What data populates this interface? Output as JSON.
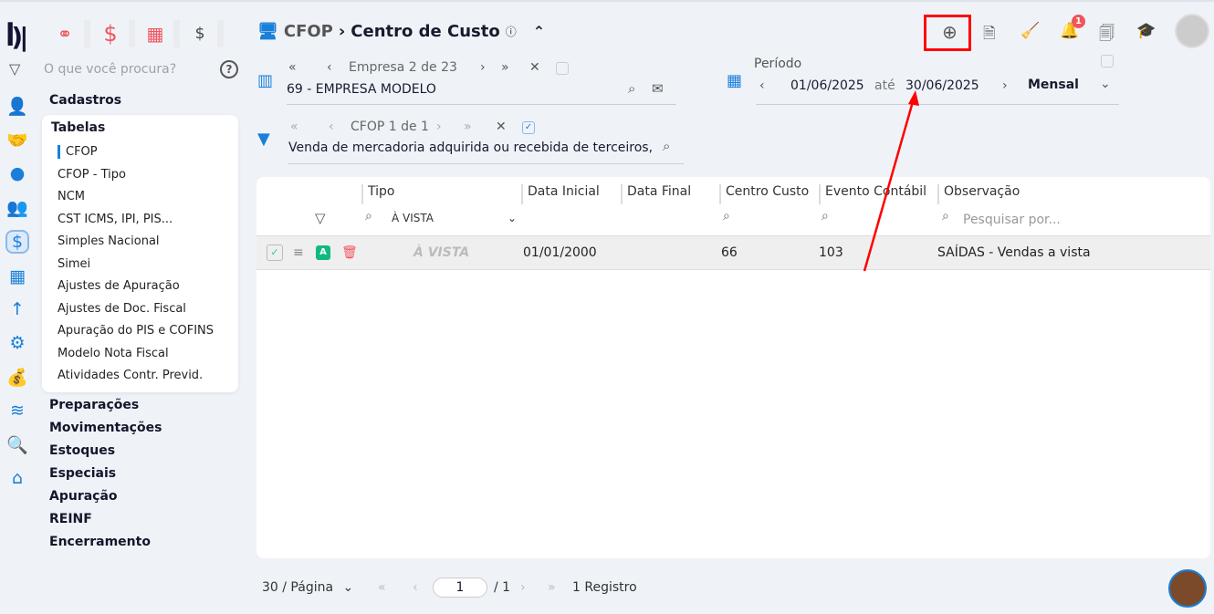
{
  "search": {
    "placeholder": "O que você procura?",
    "help": "?"
  },
  "logo": "PI",
  "modules": [
    {
      "icon": "people-icon",
      "glyph": "👥"
    },
    {
      "icon": "dollar-icon",
      "glyph": "$"
    },
    {
      "icon": "calculator-icon",
      "glyph": "▦"
    },
    {
      "icon": "money-bag-icon",
      "glyph": "💰"
    }
  ],
  "menu": {
    "cadastros": "Cadastros",
    "tabelas": "Tabelas",
    "tabelas_items": [
      "CFOP",
      "CFOP - Tipo",
      "NCM",
      "CST ICMS, IPI, PIS...",
      "Simples Nacional",
      "Simei",
      "Ajustes de Apuração",
      "Ajustes de Doc. Fiscal",
      "Apuração do PIS e COFINS",
      "Modelo Nota Fiscal",
      "Atividades Contr. Previd."
    ],
    "sections": [
      "Preparações",
      "Movimentações",
      "Estoques",
      "Especiais",
      "Apuração",
      "REINF",
      "Encerramento"
    ]
  },
  "breadcrumb": {
    "parent": "CFOP",
    "current": "Centro de Custo"
  },
  "empresa": {
    "nav": "Empresa",
    "pos": "2",
    "of": "de 23",
    "value": "69 - EMPRESA MODELO"
  },
  "periodo": {
    "label": "Período",
    "start": "01/06/2025",
    "sep": "até",
    "end": "30/06/2025",
    "mode": "Mensal"
  },
  "cfop": {
    "nav": "CFOP 1 de 1",
    "value": "Venda de mercadoria adquirida ou recebida de terceiros,"
  },
  "notifications": {
    "count": "1"
  },
  "table": {
    "headers": [
      "Tipo",
      "Data Inicial",
      "Data Final",
      "Centro Custo",
      "Evento Contábil",
      "Observação"
    ],
    "tipo_filter": "À VISTA",
    "obs_placeholder": "Pesquisar por...",
    "rows": [
      {
        "badge": "A",
        "tipo": "À VISTA",
        "data_inicial": "01/01/2000",
        "data_final": "",
        "centro_custo": "66",
        "evento": "103",
        "obs": "SAÍDAS - Vendas a vista"
      }
    ]
  },
  "pagination": {
    "per_page": "30 / Página",
    "page": "1",
    "total_pages": "/ 1",
    "records": "1 Registro"
  },
  "colors": {
    "accent": "#1a7fd9",
    "danger": "#f0545c",
    "highlight": "#ff0000"
  }
}
